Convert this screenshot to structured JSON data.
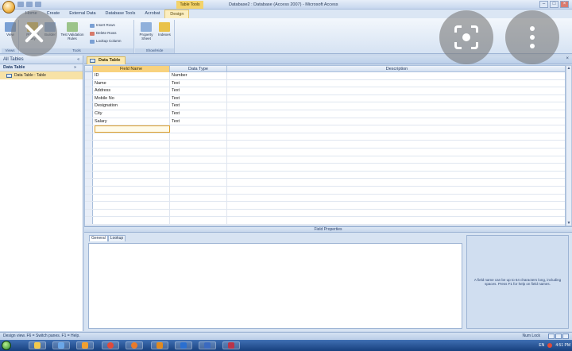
{
  "titlebar": {
    "context_title": "Table Tools",
    "app_title": "Database2 : Database (Access 2007) - Microsoft Access",
    "min": "–",
    "max": "□",
    "close": "×"
  },
  "ribbon": {
    "tabs": [
      "Home",
      "Create",
      "External Data",
      "Database Tools",
      "Acrobat",
      "Design"
    ],
    "groups": {
      "views": {
        "label": "Views",
        "view_button": "View"
      },
      "tools": {
        "label": "Tools",
        "primary_key": "Primary Key",
        "builder": "Builder",
        "test_validation": "Test Validation Rules",
        "insert_rows": "Insert Rows",
        "delete_rows": "Delete Rows",
        "lookup_column": "Lookup Column"
      },
      "show_hide": {
        "label": "Show/Hide",
        "property_sheet": "Property Sheet",
        "indexes": "Indexes"
      }
    }
  },
  "nav": {
    "header": "All Tables",
    "header_ctrl": "« ",
    "group": "Data Table",
    "group_chevron": "»",
    "item": "Data Table : Table"
  },
  "doc_tab": {
    "label": "Data Table",
    "close": "×"
  },
  "grid": {
    "headers": {
      "name": "Field Name",
      "type": "Data Type",
      "description": "Description"
    },
    "rows": [
      {
        "name": "ID",
        "type": "Number",
        "description": ""
      },
      {
        "name": "Name",
        "type": "Text",
        "description": ""
      },
      {
        "name": "Address",
        "type": "Text",
        "description": ""
      },
      {
        "name": "Mobile No",
        "type": "Text",
        "description": ""
      },
      {
        "name": "Designation",
        "type": "Text",
        "description": ""
      },
      {
        "name": "City",
        "type": "Text",
        "description": ""
      },
      {
        "name": "Salary",
        "type": "Text",
        "description": ""
      },
      {
        "name": "",
        "type": "",
        "description": ""
      },
      {
        "name": "",
        "type": "",
        "description": ""
      },
      {
        "name": "",
        "type": "",
        "description": ""
      },
      {
        "name": "",
        "type": "",
        "description": ""
      },
      {
        "name": "",
        "type": "",
        "description": ""
      },
      {
        "name": "",
        "type": "",
        "description": ""
      },
      {
        "name": "",
        "type": "",
        "description": ""
      },
      {
        "name": "",
        "type": "",
        "description": ""
      },
      {
        "name": "",
        "type": "",
        "description": ""
      },
      {
        "name": "",
        "type": "",
        "description": ""
      },
      {
        "name": "",
        "type": "",
        "description": ""
      },
      {
        "name": "",
        "type": "",
        "description": ""
      },
      {
        "name": "",
        "type": "",
        "description": ""
      }
    ]
  },
  "field_properties": {
    "title": "Field Properties",
    "tabs": [
      "General",
      "Lookup"
    ],
    "help": "A field name can be up to 64 characters long, including spaces. Press F1 for help on field names."
  },
  "statusbar": {
    "left": "Design view.  F6 = Switch panes.  F1 = Help.",
    "right": "Num Lock"
  },
  "taskbar": {
    "time": "4:51 PM",
    "lang": "EN"
  },
  "colors": {
    "accent": "#f8d27e",
    "ribbon": "#d6e3f3",
    "taskbar": "#17407e"
  }
}
